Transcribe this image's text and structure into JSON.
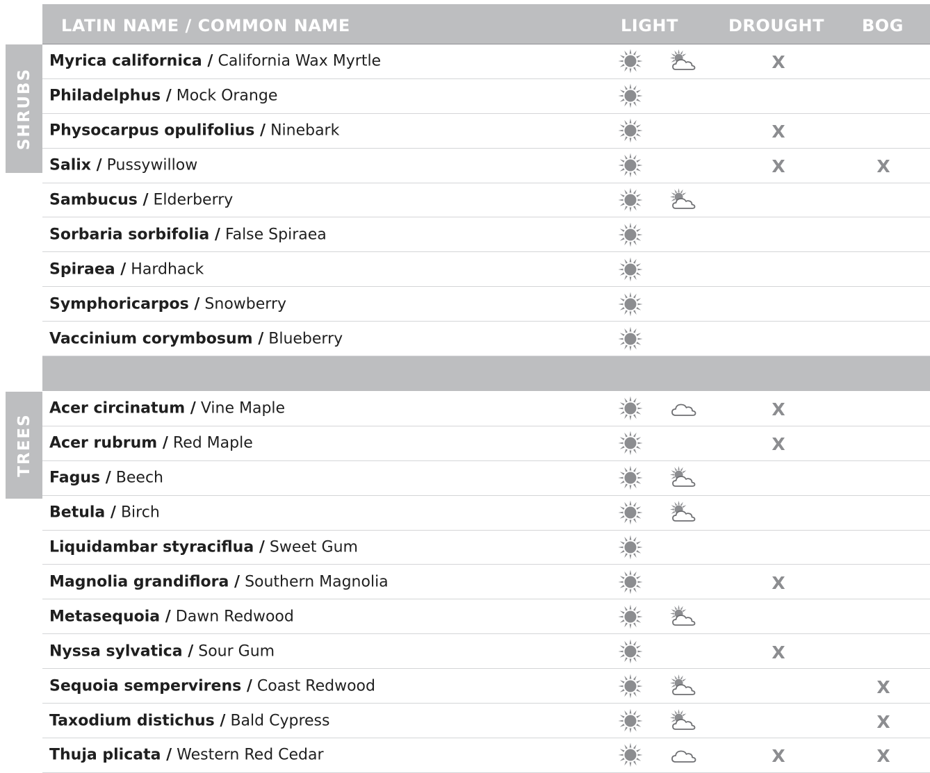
{
  "header": {
    "name_col": "LATIN NAME / COMMON NAME",
    "light": "LIGHT",
    "drought": "DROUGHT",
    "bog": "BOG"
  },
  "sections": [
    {
      "label": "SHRUBS",
      "rows": [
        {
          "latin": "Myrica californica /",
          "common": "California Wax Myrtle",
          "light": [
            "sun-icon",
            "part-sun-icon"
          ],
          "drought": "X",
          "bog": ""
        },
        {
          "latin": "Philadelphus /",
          "common": "Mock Orange",
          "light": [
            "sun-icon"
          ],
          "drought": "",
          "bog": ""
        },
        {
          "latin": "Physocarpus opulifolius /",
          "common": "Ninebark",
          "light": [
            "sun-icon"
          ],
          "drought": "X",
          "bog": ""
        },
        {
          "latin": "Salix /",
          "common": "Pussywillow",
          "light": [
            "sun-icon"
          ],
          "drought": "X",
          "bog": "X"
        },
        {
          "latin": "Sambucus /",
          "common": "Elderberry",
          "light": [
            "sun-icon",
            "part-sun-icon"
          ],
          "drought": "",
          "bog": ""
        },
        {
          "latin": "Sorbaria sorbifolia /",
          "common": "False Spiraea",
          "light": [
            "sun-icon"
          ],
          "drought": "",
          "bog": ""
        },
        {
          "latin": "Spiraea /",
          "common": "Hardhack",
          "light": [
            "sun-icon"
          ],
          "drought": "",
          "bog": ""
        },
        {
          "latin": "Symphoricarpos /",
          "common": "Snowberry",
          "light": [
            "sun-icon"
          ],
          "drought": "",
          "bog": ""
        },
        {
          "latin": "Vaccinium corymbosum /",
          "common": "Blueberry",
          "light": [
            "sun-icon"
          ],
          "drought": "",
          "bog": ""
        }
      ]
    },
    {
      "label": "TREES",
      "rows": [
        {
          "latin": "Acer circinatum /",
          "common": "Vine Maple",
          "light": [
            "sun-icon",
            "shade-icon"
          ],
          "drought": "X",
          "bog": ""
        },
        {
          "latin": "Acer rubrum /",
          "common": "Red Maple",
          "light": [
            "sun-icon"
          ],
          "drought": "X",
          "bog": ""
        },
        {
          "latin": "Fagus /",
          "common": "Beech",
          "light": [
            "sun-icon",
            "part-sun-icon"
          ],
          "drought": "",
          "bog": ""
        },
        {
          "latin": "Betula /",
          "common": "Birch",
          "light": [
            "sun-icon",
            "part-sun-icon"
          ],
          "drought": "",
          "bog": ""
        },
        {
          "latin": "Liquidambar styraciflua /",
          "common": "Sweet Gum",
          "light": [
            "sun-icon"
          ],
          "drought": "",
          "bog": ""
        },
        {
          "latin": "Magnolia grandiflora /",
          "common": "Southern Magnolia",
          "light": [
            "sun-icon"
          ],
          "drought": "X",
          "bog": ""
        },
        {
          "latin": "Metasequoia /",
          "common": "Dawn Redwood",
          "light": [
            "sun-icon",
            "part-sun-icon"
          ],
          "drought": "",
          "bog": ""
        },
        {
          "latin": "Nyssa sylvatica /",
          "common": "Sour Gum",
          "light": [
            "sun-icon"
          ],
          "drought": "X",
          "bog": ""
        },
        {
          "latin": "Sequoia sempervirens /",
          "common": "Coast Redwood",
          "light": [
            "sun-icon",
            "part-sun-icon"
          ],
          "drought": "",
          "bog": "X"
        },
        {
          "latin": "Taxodium distichus /",
          "common": "Bald Cypress",
          "light": [
            "sun-icon",
            "part-sun-icon"
          ],
          "drought": "",
          "bog": "X"
        },
        {
          "latin": "Thuja plicata /",
          "common": "Western Red Cedar",
          "light": [
            "sun-icon",
            "shade-icon"
          ],
          "drought": "X",
          "bog": "X"
        }
      ]
    }
  ],
  "colors": {
    "header_bg": "#bdbec0",
    "header_text": "#ffffff",
    "mark": "#8c8d90",
    "icon": "#8c8d90"
  }
}
